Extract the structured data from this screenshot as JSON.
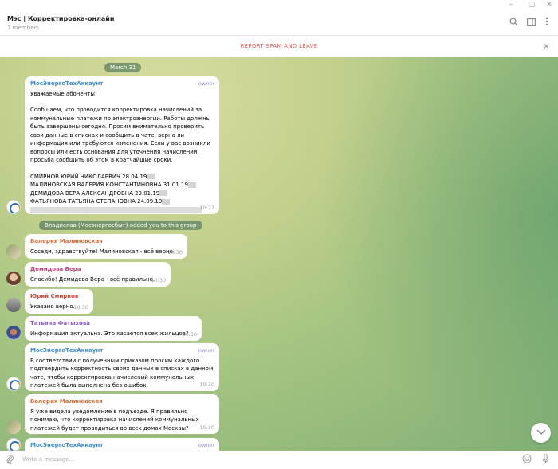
{
  "window": {
    "minimize": "‒",
    "maximize": "▢",
    "close": "✕"
  },
  "header": {
    "title": "Мэс | Корректировка-онлайн",
    "subtitle": "7 members",
    "search_icon": "search-icon",
    "sidebar_icon": "sidebar-icon",
    "menu_icon": "more-vertical-icon"
  },
  "spam": {
    "label": "REPORT SPAM AND LEAVE",
    "close": "✕"
  },
  "chat": {
    "date": "March 31",
    "service": "Владислав (Мосэнергосбыт) added you to this group",
    "messages": [
      {
        "author": "МосЭнергоТехАккаунт",
        "badge": "owner",
        "time": "10:27",
        "lines": [
          "Уважаемые абоненты!",
          "",
          "Сообщаем, что проводится корректировка начислений за коммунальные платежи по электроэнергии. Работы должны быть завершены сегодня. Просим внимательно проверить свои данные в списках и сообщить в чате, верна ли информация или требуются изменения. Если у вас возникли вопросы или есть основания для уточнения начислений, просьба сообщить об этом в кратчайшие сроки.",
          "",
          "СМИРНОВ ЮРИЙ НИКОЛАЕВИЧ 28.04.19",
          "МАЛИНОВСКАЯ ВАЛЕРИЯ КОНСТАНТИНОВНА 31.01.19",
          "ДЕМИДОВА ВЕРА АЛЕКСАНДРОВНА 29.01.19",
          "ФАТЬЯНОВА ТАТЬЯНА СТЕПАНОВНА 24.09.19"
        ]
      },
      {
        "author": "Валерия Малиновская",
        "text": "Соседи, здравствуйте! Малиновская - всё верно.",
        "time": "10:30"
      },
      {
        "author": "Демидова Вера",
        "text": "Спасибо! Демидова Вера - всё правильно.",
        "time": "10:30"
      },
      {
        "author": "Юрий Смирнов",
        "text": "Указано верно.",
        "time": "10:30"
      },
      {
        "author": "Татьяна Фатыхова",
        "text": "Информация актуальна. Это касается всех жильцов?",
        "time": "10:30"
      },
      {
        "author": "МосЭнергоТехАккаунт",
        "badge": "owner",
        "text": "В соответствии с полученным приказом просим каждого подтвердить корректность своих данных в списках в данном чате, чтобы корректировка начислений коммунальных платежей была выполнена без ошибок.",
        "time": "10:30"
      },
      {
        "author": "Валерия Малиновская",
        "text": "Я уже видела уведомление в подъезде. Я правильно понимаю, что корректировка начислений коммунальных платежей будет проводиться во всех домах Москвы?",
        "time": "10:30"
      },
      {
        "author": "МосЭнергоТехАккаунт",
        "badge": "owner"
      }
    ]
  },
  "composer": {
    "placeholder": "Write a message...",
    "attach_icon": "paperclip-icon",
    "emoji_icon": "emoji-icon",
    "mic_icon": "microphone-icon"
  },
  "colors": {
    "accent": "#3a8ed5",
    "spam": "#e05a4e",
    "chat_bg": "#b8cc88"
  }
}
